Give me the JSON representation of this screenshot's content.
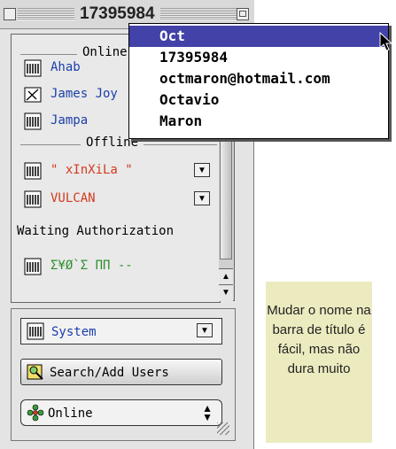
{
  "window": {
    "title": "17395984"
  },
  "groups": {
    "online": "Online",
    "offline": "Offline",
    "waiting": "Waiting Authorization"
  },
  "contacts": {
    "online": [
      {
        "name": "Ahab",
        "color": "#1b3faa"
      },
      {
        "name": "James Joy",
        "color": "#1b3faa"
      },
      {
        "name": "Jampa",
        "color": "#1b3faa"
      }
    ],
    "offline": [
      {
        "name": "\" xInXiLa \"",
        "color": "#d23a1e"
      },
      {
        "name": "VULCAN",
        "color": "#d23a1e"
      }
    ],
    "waiting": [
      {
        "name": "Σ¥Ø`Σ ΠΠ --",
        "color": "#2f8f2f"
      }
    ]
  },
  "lower": {
    "system_label": "System",
    "search_label": "Search/Add Users",
    "status_label": "Online"
  },
  "popup": {
    "items": [
      "Oct",
      "17395984",
      "octmaron@hotmail.com",
      "Octavio",
      "Maron"
    ],
    "selected_index": 0,
    "selected_color": "#4242a8"
  },
  "note": {
    "text": "Mudar o nome na barra de título é fácil, mas não dura muito",
    "background": "#ecebc0"
  }
}
